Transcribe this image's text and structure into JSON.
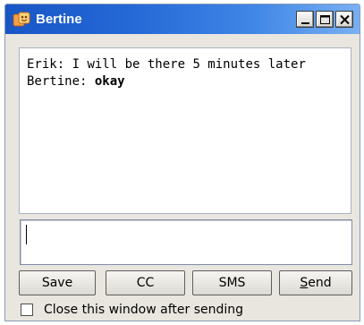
{
  "window": {
    "title": "Bertine",
    "colors": {
      "titlebar": "#1856c6",
      "face": "#e9e6df"
    }
  },
  "chat": {
    "messages": [
      {
        "sender_label": "Erik:",
        "text": "I will be there 5 minutes later",
        "bold": false
      },
      {
        "sender_label": "Bertine:",
        "text": "okay",
        "bold": true
      }
    ]
  },
  "compose": {
    "value": ""
  },
  "buttons": {
    "save": "Save",
    "cc": "CC",
    "sms": "SMS",
    "send_prefix": "S",
    "send_rest": "end"
  },
  "options": {
    "close_after_sending_label": "Close this window after sending",
    "close_after_sending_checked": false
  },
  "icons": [
    "chat-icon",
    "minimize-icon",
    "maximize-icon",
    "close-icon"
  ]
}
